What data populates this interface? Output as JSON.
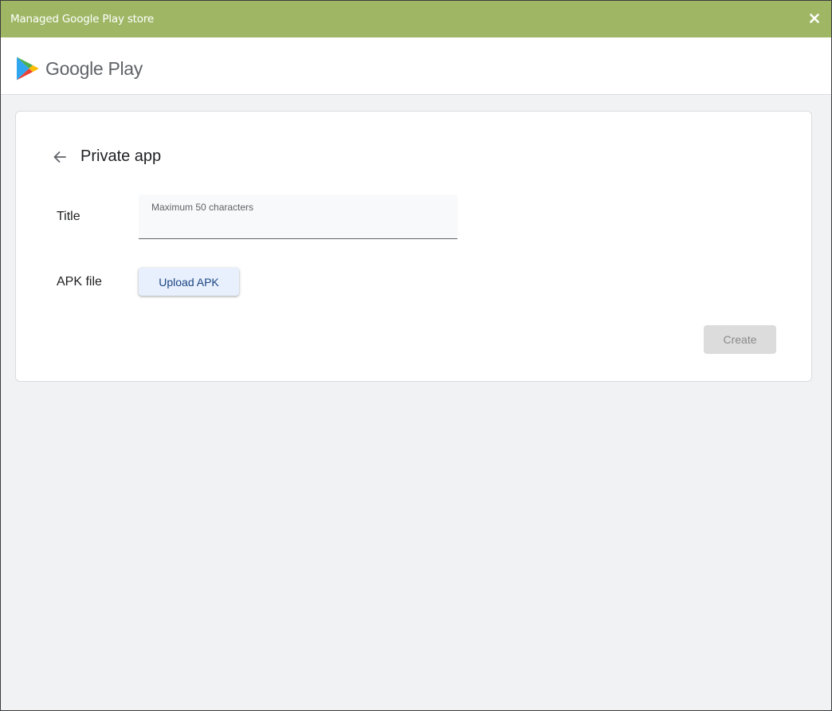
{
  "window": {
    "title": "Managed Google Play store"
  },
  "header": {
    "logo_text": "Google Play"
  },
  "form": {
    "page_title": "Private app",
    "title_label": "Title",
    "title_value": "",
    "title_hint": "Maximum 50 characters",
    "apk_label": "APK file",
    "upload_button_label": "Upload APK",
    "create_button_label": "Create",
    "create_button_disabled": true
  },
  "icons": {
    "close": "close-icon",
    "back": "arrow-back-icon",
    "logo": "google-play-logo-icon"
  },
  "colors": {
    "titlebar": "#9fb765",
    "background": "#f1f2f4",
    "card": "#ffffff",
    "upload_button_bg": "#e8f0fe",
    "upload_button_text": "#1a4480",
    "create_button_bg": "#dcdcdc",
    "create_button_text": "#8a8a8a"
  }
}
